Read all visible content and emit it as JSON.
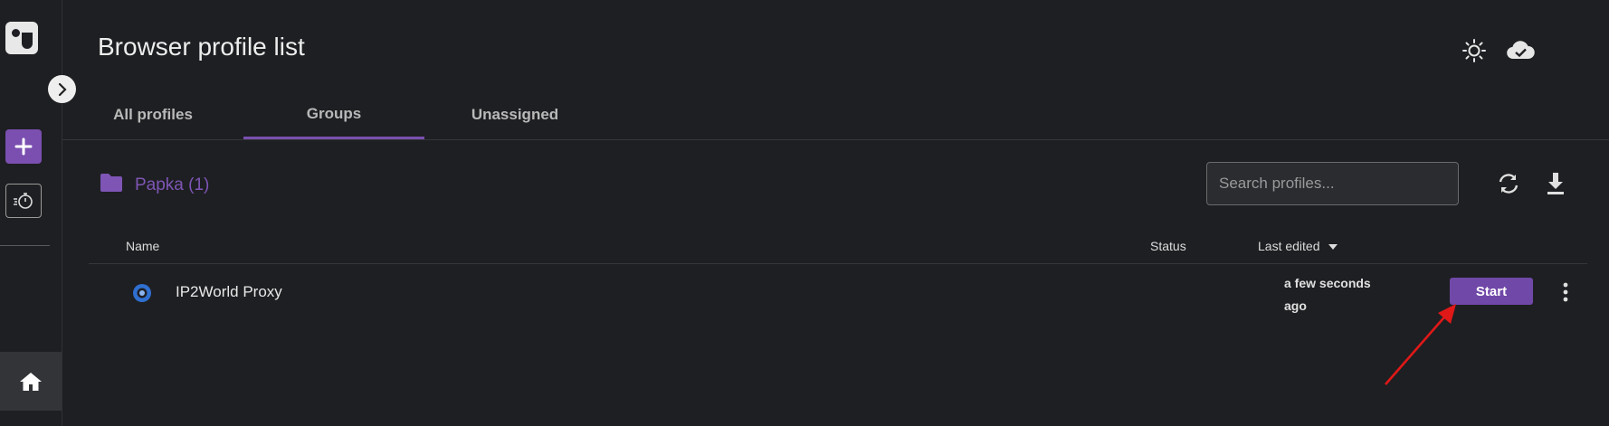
{
  "header": {
    "title": "Browser profile list",
    "theme_icon": "sun-icon",
    "cloud_icon": "cloud-check-icon"
  },
  "sidebar": {
    "logo_icon": "app-logo",
    "toggle_icon": "chevron-right-icon",
    "add_icon": "plus-icon",
    "timer_icon": "stopwatch-icon",
    "home_icon": "home-icon"
  },
  "tabs": [
    {
      "label": "All profiles",
      "active": false
    },
    {
      "label": "Groups",
      "active": true
    },
    {
      "label": "Unassigned",
      "active": false
    }
  ],
  "group": {
    "icon": "folder-icon",
    "name": "Papka (1)"
  },
  "search": {
    "placeholder": "Search profiles...",
    "value": ""
  },
  "toolbar": {
    "sync_icon": "sync-icon",
    "download_icon": "download-icon"
  },
  "table": {
    "columns": {
      "name": "Name",
      "status": "Status",
      "last_edited": "Last edited"
    },
    "sort_icon": "caret-down-icon",
    "rows": [
      {
        "browser_icon": "browser-icon",
        "name": "IP2World Proxy",
        "status": "",
        "last_edited": "a few seconds ago",
        "action_label": "Start",
        "menu_icon": "more-vertical-icon"
      }
    ]
  },
  "colors": {
    "background": "#1e1f22",
    "accent": "#7a4fb0",
    "start_button": "#7048a8",
    "annotation_arrow": "#e01818"
  }
}
